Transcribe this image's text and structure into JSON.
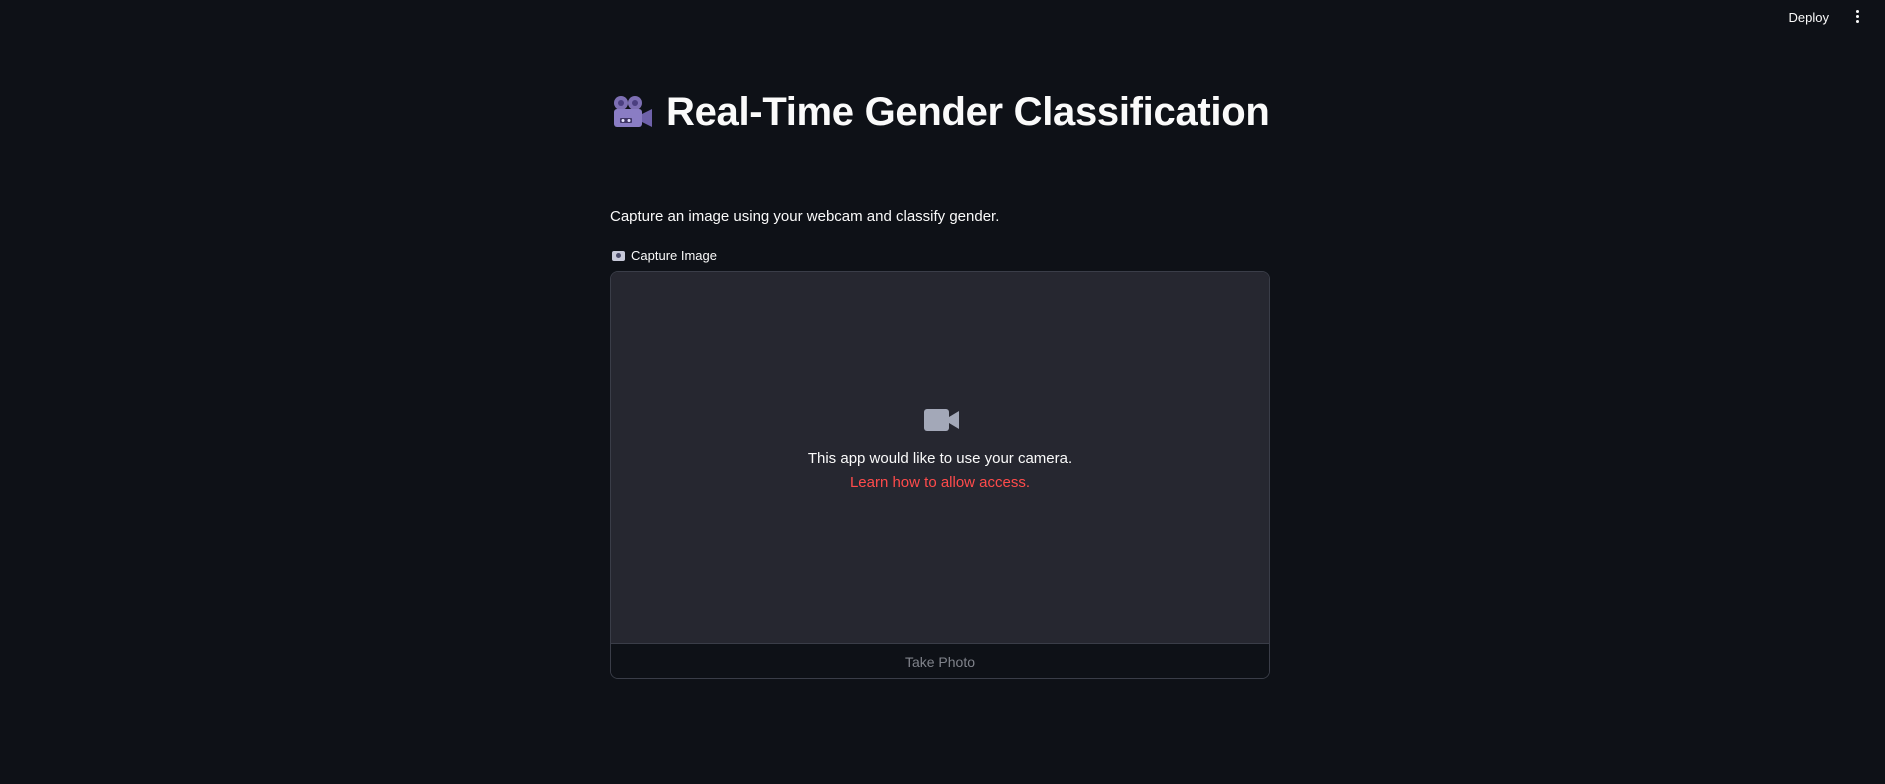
{
  "header": {
    "deploy_label": "Deploy",
    "menu_icon": "more-vert-icon"
  },
  "main": {
    "title_icon": "movie-camera-icon",
    "title": "Real-Time Gender Classification",
    "subtitle": "Capture an image using your webcam and classify gender.",
    "camera_input": {
      "label_icon": "camera-icon",
      "label": "Capture Image",
      "placeholder_icon": "video-camera-icon",
      "permission_message": "This app would like to use your camera.",
      "help_link": "Learn how to allow access.",
      "take_photo_label": "Take Photo"
    }
  },
  "colors": {
    "background": "#0e1117",
    "camera_area": "#262730",
    "link": "#ff4b4b",
    "disabled_text": "#80838b"
  }
}
